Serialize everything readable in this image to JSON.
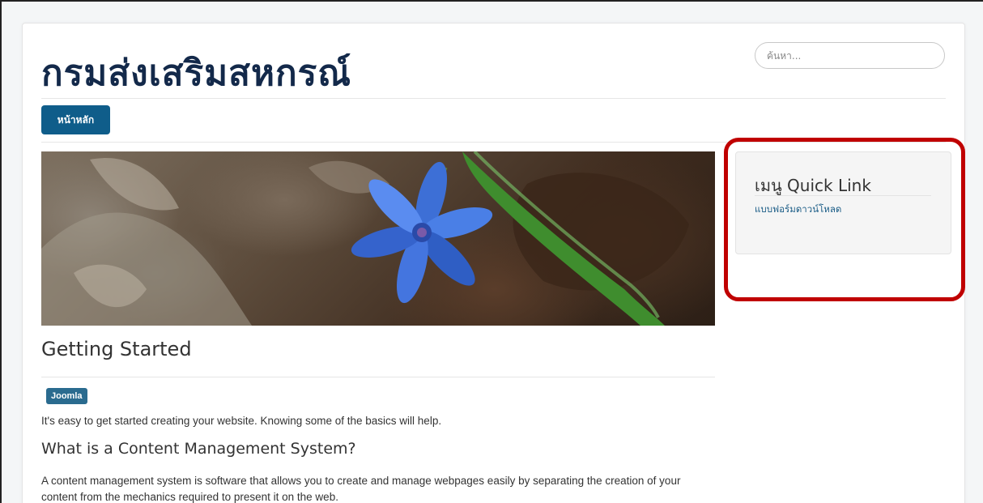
{
  "header": {
    "site_title": "กรมส่งเสริมสหกรณ์",
    "search_placeholder": "ค้นหา..."
  },
  "nav": {
    "home_label": "หน้าหลัก"
  },
  "article": {
    "title": "Getting Started",
    "tag": "Joomla",
    "intro": "It's easy to get started creating your website. Knowing some of the basics will help.",
    "subheading": "What is a Content Management System?",
    "paragraph": "A content management system is software that allows you to create and manage webpages easily by separating the creation of your content from the mechanics required to present it on the web."
  },
  "sidebar": {
    "title": "เมนู Quick Link",
    "link": "แบบฟอร์มดาวน์โหลด"
  },
  "colors": {
    "brand_dark": "#13294a",
    "nav_button": "#0f5d8a",
    "tag": "#2a6b8f",
    "link": "#1a5c86",
    "highlight": "#c00000"
  }
}
